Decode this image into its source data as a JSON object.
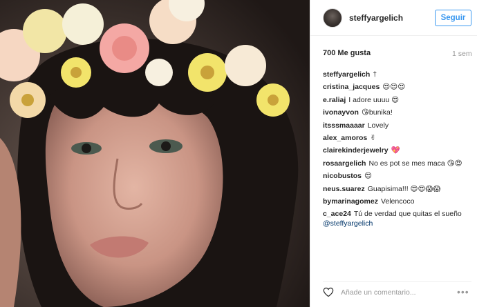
{
  "post": {
    "image_alt": "",
    "username": "steffyargelich",
    "follow_label": "Seguir",
    "likes": "700 Me gusta",
    "time_ago": "1 sem"
  },
  "comments": [
    {
      "user": "steffyargelich",
      "text": "†"
    },
    {
      "user": "cristina_jacques",
      "text": "😍😍😍"
    },
    {
      "user": "e.raliaj",
      "text": "I adore uuuu 😍"
    },
    {
      "user": "ivonayvon",
      "text": "😘bunika!"
    },
    {
      "user": "itsssmaaaar",
      "text": "Lovely"
    },
    {
      "user": "alex_amoros",
      "text": "✌"
    },
    {
      "user": "clairekinderjewelry",
      "text": "💖"
    },
    {
      "user": "rosaargelich",
      "text": "No es pot se mes maca 😘😍"
    },
    {
      "user": "nicobustos",
      "text": "😍"
    },
    {
      "user": "neus.suarez",
      "text": "Guapisima!!! 😍😍😱😱"
    },
    {
      "user": "bymarinagomez",
      "text": "Velencoco"
    },
    {
      "user": "c_ace24",
      "text": "Tú de verdad que quitas el sueño",
      "mention": "@steffyargelich"
    }
  ],
  "footer": {
    "comment_placeholder": "Añade un comentario...",
    "more_label": "•••"
  },
  "colors": {
    "accent": "#3897f0",
    "mention": "#003569",
    "muted": "#999999",
    "text": "#262626"
  }
}
